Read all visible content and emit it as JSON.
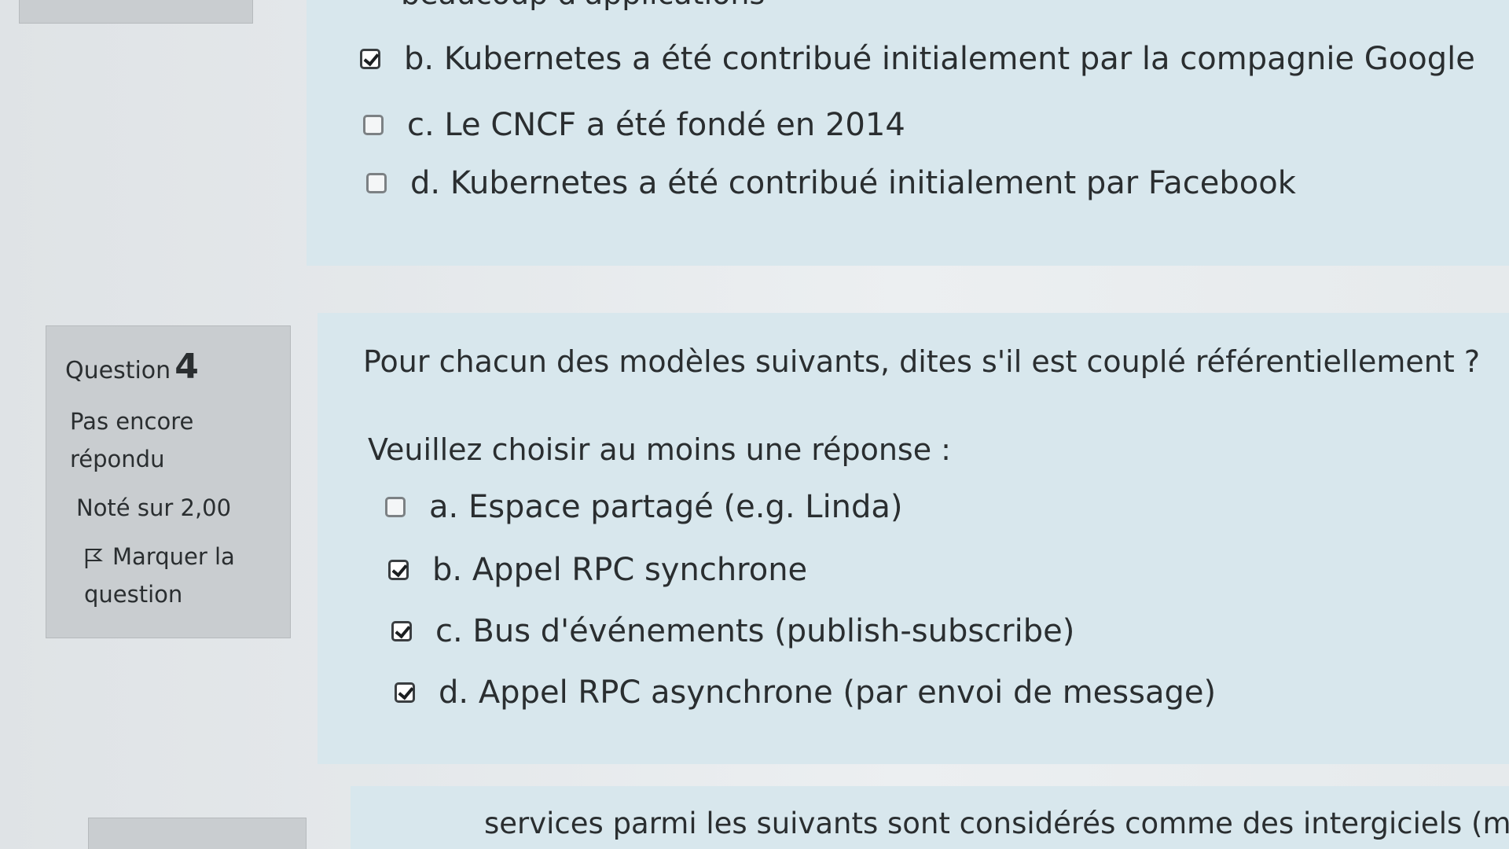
{
  "question3": {
    "top_text_fragment": "beaucoup d'applications",
    "options": [
      {
        "label": "b. Kubernetes a été contribué initialement par la compagnie Google",
        "checked": true
      },
      {
        "label": "c. Le CNCF a été fondé en 2014",
        "checked": false
      },
      {
        "label": "d. Kubernetes a été contribué initialement par Facebook",
        "checked": false
      }
    ]
  },
  "question4": {
    "label": "Question",
    "number": "4",
    "status": "Pas encore répondu",
    "grade": "Noté sur 2,00",
    "flag_label": "Marquer la question",
    "prompt": "Pour chacun des modèles suivants, dites s'il est couplé référentiellement ?",
    "instruction": "Veuillez choisir au moins une réponse :",
    "options": [
      {
        "label": "a. Espace partagé (e.g. Linda)",
        "checked": false
      },
      {
        "label": "b. Appel RPC synchrone",
        "checked": true
      },
      {
        "label": "c. Bus d'événements (publish-subscribe)",
        "checked": true
      },
      {
        "label": "d. Appel RPC asynchrone (par envoi de message)",
        "checked": true
      }
    ]
  },
  "question5": {
    "prompt_fragment": "services parmi les suivants sont considérés comme des intergiciels (middleware) ?"
  },
  "colors": {
    "content_bg": "#d8e7ed",
    "info_bg": "#c9cdd0",
    "page_bg": "#e9ecee"
  }
}
